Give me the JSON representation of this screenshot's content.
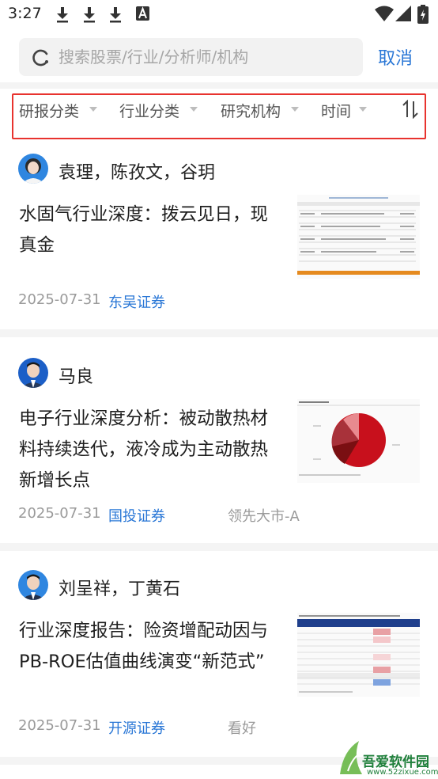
{
  "status_bar": {
    "time": "3:27",
    "icons": [
      "download-icon",
      "download-icon",
      "download-icon",
      "a-icon",
      "wifi-icon",
      "signal-icon",
      "battery-icon"
    ]
  },
  "search": {
    "placeholder": "搜索股票/行业/分析师/机构",
    "cancel_label": "取消"
  },
  "filters": {
    "items": [
      "研报分类",
      "行业分类",
      "研究机构",
      "时间"
    ],
    "sort_icon": "sort-icon",
    "highlight_color": "#e8332e"
  },
  "reports": [
    {
      "authors": "袁理，陈孜文，谷玥",
      "title": "水固气行业深度：拨云见日，现真金",
      "date": "2025-07-31",
      "org": "东吴证券",
      "rating": ""
    },
    {
      "authors": "马良",
      "title": "电子行业深度分析：被动散热材料持续迭代，液冷成为主动散热新增长点",
      "date": "2025-07-31",
      "org": "国投证券",
      "rating": "领先大市-A"
    },
    {
      "authors": "刘呈祥，丁黄石",
      "title": "行业深度报告：险资增配动因与PB-ROE估值曲线演变“新范式”",
      "date": "2025-07-31",
      "org": "开源证券",
      "rating": "看好"
    }
  ],
  "watermark": {
    "text": "吾爱软件园",
    "url": "www.52zixue.com"
  },
  "colors": {
    "accent": "#2a77d6",
    "filter_border": "#e8332e",
    "pie_main": "#c8101c"
  }
}
